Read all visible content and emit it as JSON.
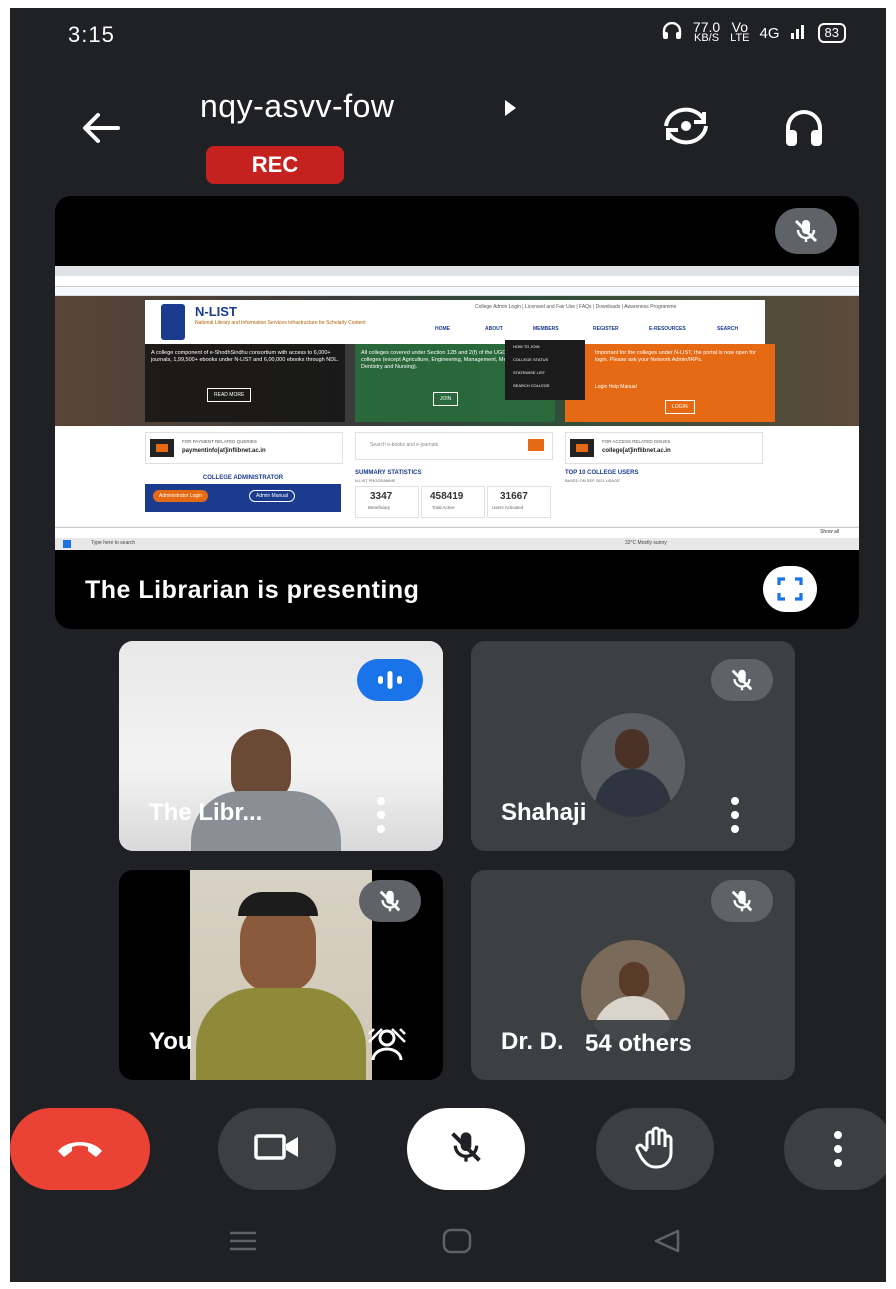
{
  "status_bar": {
    "time": "3:15",
    "net_speed_value": "77.0",
    "net_speed_unit": "KB/S",
    "volte_top": "Vo",
    "volte_bottom": "LTE",
    "network": "4G",
    "battery": "83"
  },
  "header": {
    "meeting_code": "nqy-asvv-fow",
    "rec_label": "REC"
  },
  "presentation": {
    "caption": "The Librarian is presenting",
    "shared_site": {
      "logo": "N-LIST",
      "subtitle": "National Library and Information Services Infrastructure for Scholarly Content",
      "nav": [
        "HOME",
        "ABOUT",
        "MEMBERS",
        "REGISTER",
        "E-RESOURCES",
        "SEARCH"
      ],
      "top_links": "College Admin Login | Licensed and Fair Use | FAQs | Downloads | Awareness Programme",
      "left_panel_text": "A college component of e-ShodhSindhu consortium with access to 6,000+ journals, 1,99,500+ ebooks under N-LIST and 6,00,000 ebooks through NDL.",
      "read_more": "READ MORE",
      "mid_panel_text": "All colleges covered under Section 12B and 2(f) of the UGC Act. Non-Aided colleges (except Agriculture, Engineering, Management, Medical, Pharmacy, Dentistry and Nursing).",
      "join": "JOIN",
      "dropdown": [
        "HOW TO JOIN",
        "COLLEGE STATUS",
        "STATEWISE LIST",
        "SEARCH COLLEGE"
      ],
      "right_panel_text": "Important for the colleges under N-LIST, the portal is now open for login. Please ask your Network Admin/IRPs.",
      "login_help": "Login Help Manual",
      "login": "LOGIN",
      "payment_label": "FOR PAYMENT RELATED QUERIES",
      "payment_email": "paymentinfo[at]inflibnet.ac.in",
      "search_placeholder": "Search e-books and e-journals",
      "access_label": "FOR ACCESS RELATED ISSUES",
      "access_email": "college[at]inflibnet.ac.in",
      "college_admin": "COLLEGE ADMINISTRATOR",
      "admin_login": "Administrator Login",
      "admin_manual": "Admin Manual",
      "summary_title": "SUMMARY STATISTICS",
      "summary_sub": "N-LIST PROGRAMME",
      "stats": [
        {
          "value": "3347",
          "label": "Beneficiary"
        },
        {
          "value": "458419",
          "label": "Total Active"
        },
        {
          "value": "31667",
          "label": "Users Activated"
        }
      ],
      "top10_title": "TOP 10 COLLEGE USERS",
      "top10_sub": "BASED ON SEP 2021 USAGE",
      "taskbar_search": "Type here to search",
      "weather": "32°C Mostly sunny",
      "show_all": "Show all"
    }
  },
  "participants": [
    {
      "name": "The Libr...",
      "state": "speaking"
    },
    {
      "name": "Shahaji",
      "state": "muted"
    },
    {
      "name": "You",
      "state": "muted"
    },
    {
      "name": "Dr. D.",
      "state": "muted",
      "others_label": "54 others"
    }
  ],
  "colors": {
    "background": "#202124",
    "tile": "#3c4043",
    "end_call": "#ea4335",
    "rec": "#c5221f",
    "speaking_badge": "#1a73e8"
  },
  "icons": [
    "back-arrow-icon",
    "switch-camera-icon",
    "headphones-icon",
    "mic-off-icon",
    "fullscreen-icon",
    "audio-level-icon",
    "more-vert-icon",
    "background-effects-icon",
    "end-call-icon",
    "camera-icon",
    "raise-hand-icon",
    "recents-icon",
    "home-icon",
    "nav-back-icon"
  ]
}
